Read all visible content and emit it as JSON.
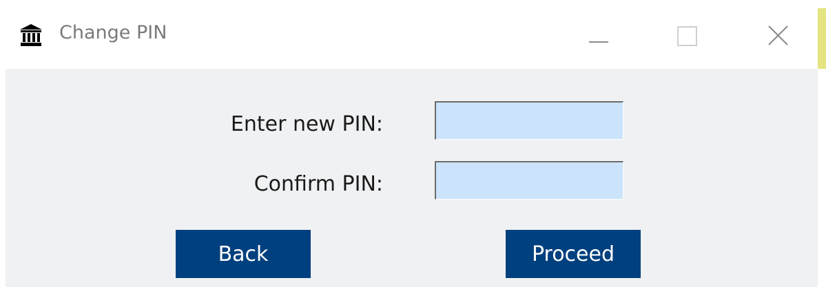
{
  "window": {
    "title": "Change PIN",
    "app_icon": "bank-building-icon",
    "controls": {
      "minimize_icon": "minimize-icon",
      "maximize_icon": "maximize-icon",
      "close_icon": "close-icon"
    }
  },
  "form": {
    "new_pin_label": "Enter new PIN:",
    "new_pin_value": "",
    "confirm_pin_label": "Confirm PIN:",
    "confirm_pin_value": ""
  },
  "buttons": {
    "back_label": "Back",
    "proceed_label": "Proceed"
  },
  "colors": {
    "button_bg": "#00407e",
    "button_text": "#ffffff",
    "field_bg": "#cce4fb",
    "client_bg": "#f0f1f3",
    "title_text": "#7a7a7a"
  }
}
